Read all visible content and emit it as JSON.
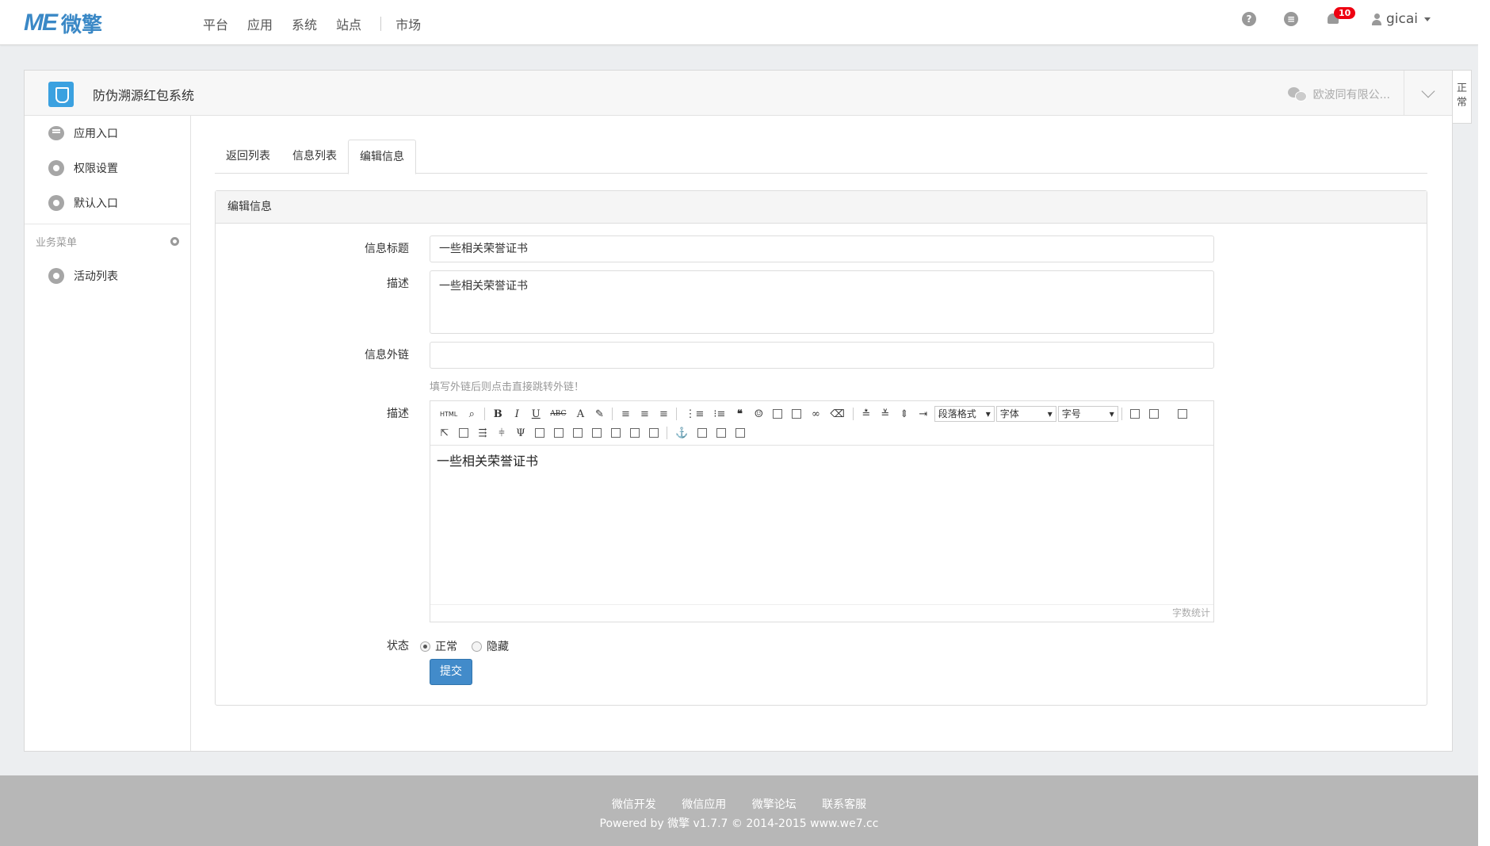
{
  "brand": {
    "logo_me": "ME",
    "logo_cn": "微擎"
  },
  "nav": {
    "items": [
      "平台",
      "应用",
      "系统",
      "站点",
      "市场"
    ]
  },
  "topbar": {
    "notifications": "10",
    "username": "gicai",
    "help_icon": "question-icon",
    "message_icon": "message-icon"
  },
  "app": {
    "title": "防伪溯源红包系统",
    "account": "欧波同有限公...",
    "side_tab": "正常"
  },
  "sidebar": {
    "items": [
      {
        "label": "应用入口",
        "icon": "chat-icon"
      },
      {
        "label": "权限设置",
        "icon": "gear-icon"
      },
      {
        "label": "默认入口",
        "icon": "gear-icon"
      }
    ],
    "section_title": "业务菜单",
    "section_items": [
      {
        "label": "活动列表",
        "icon": "gear-icon"
      }
    ]
  },
  "tabs": [
    "返回列表",
    "信息列表",
    "编辑信息"
  ],
  "form": {
    "panel_title": "编辑信息",
    "title_label": "信息标题",
    "title_value": "一些相关荣誉证书",
    "desc_label": "描述",
    "desc_value": "一些相关荣誉证书",
    "link_label": "信息外链",
    "link_value": "",
    "link_help": "填写外链后则点击直接跳转外链！",
    "content_label": "描述",
    "editor": {
      "toolbar_row1": [
        "HTML",
        "B",
        "I",
        "U",
        "ABC",
        "A",
        "段落格式",
        "字体",
        "字号"
      ],
      "content": "一些相关荣誉证书",
      "footer": "字数统计"
    },
    "status_label": "状态",
    "status_options": [
      "正常",
      "隐藏"
    ],
    "status_selected": "正常",
    "submit": "提交"
  },
  "footer": {
    "links": [
      "微信开发",
      "微信应用",
      "微擎论坛",
      "联系客服"
    ],
    "copyright": "Powered by 微擎 v1.7.7 © 2014-2015 www.we7.cc"
  }
}
